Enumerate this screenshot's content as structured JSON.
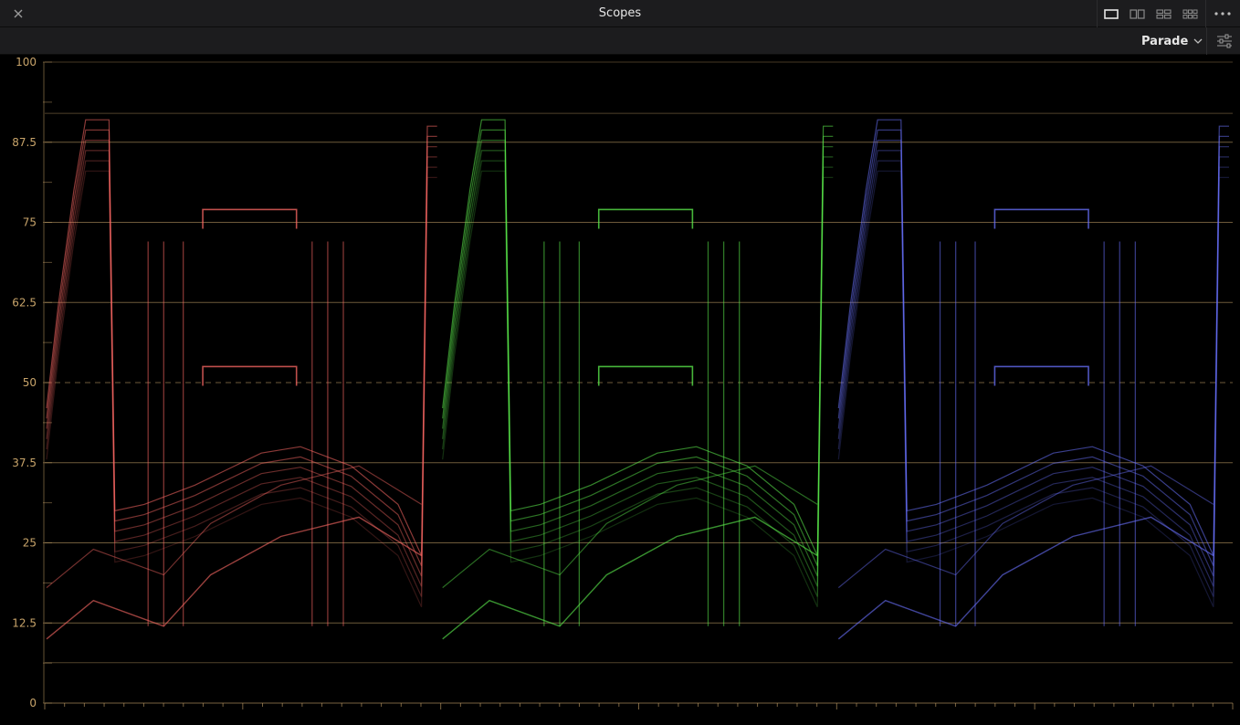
{
  "window": {
    "title": "Scopes",
    "close_icon": "close-icon",
    "layout_icons": [
      "single-view-icon",
      "dual-view-icon",
      "quad-view-icon",
      "six-view-icon"
    ],
    "more_icon": "more-horizontal-icon"
  },
  "toolbar": {
    "mode": "Parade",
    "mode_icon": "chevron-down-icon",
    "settings_icon": "sliders-icon"
  },
  "colors": {
    "graticule": "#c8a46a",
    "red_channel": "#ff6a66",
    "green_channel": "#5ef24e",
    "blue_channel": "#6a72ff"
  },
  "scope": {
    "type": "RGB Parade",
    "channels": [
      "red",
      "green",
      "blue"
    ],
    "y_range": [
      0,
      100
    ],
    "y_ticks": [
      {
        "value": 100,
        "label": "100"
      },
      {
        "value": 87.5,
        "label": "87.5"
      },
      {
        "value": 75,
        "label": "75"
      },
      {
        "value": 62.5,
        "label": "62.5"
      },
      {
        "value": 50,
        "label": "50"
      },
      {
        "value": 37.5,
        "label": "37.5"
      },
      {
        "value": 25,
        "label": "25"
      },
      {
        "value": 12.5,
        "label": "12.5"
      },
      {
        "value": 0,
        "label": "0"
      }
    ],
    "limit_lines": [
      92,
      6.3
    ],
    "dashed_line": 50,
    "trace_shape": [
      {
        "x": 0,
        "y": 46
      },
      {
        "x": 0.03,
        "y": 62
      },
      {
        "x": 0.07,
        "y": 80
      },
      {
        "x": 0.1,
        "y": 91
      },
      {
        "x": 0.16,
        "y": 91
      },
      {
        "x": 0.175,
        "y": 30
      },
      {
        "x": 0.25,
        "y": 31
      },
      {
        "x": 0.38,
        "y": 34
      },
      {
        "x": 0.55,
        "y": 39
      },
      {
        "x": 0.65,
        "y": 40
      },
      {
        "x": 0.78,
        "y": 37
      },
      {
        "x": 0.9,
        "y": 31
      },
      {
        "x": 0.96,
        "y": 23
      },
      {
        "x": 0.975,
        "y": 90
      },
      {
        "x": 1,
        "y": 90
      }
    ],
    "lower_trace": [
      {
        "x": 0,
        "y": 10
      },
      {
        "x": 0.12,
        "y": 16
      },
      {
        "x": 0.3,
        "y": 12
      },
      {
        "x": 0.42,
        "y": 20
      },
      {
        "x": 0.6,
        "y": 26
      },
      {
        "x": 0.8,
        "y": 29
      },
      {
        "x": 0.96,
        "y": 23
      }
    ],
    "plateaus": [
      {
        "x1": 0.4,
        "x2": 0.64,
        "y": 77
      },
      {
        "x1": 0.4,
        "x2": 0.64,
        "y": 52.5
      }
    ]
  }
}
